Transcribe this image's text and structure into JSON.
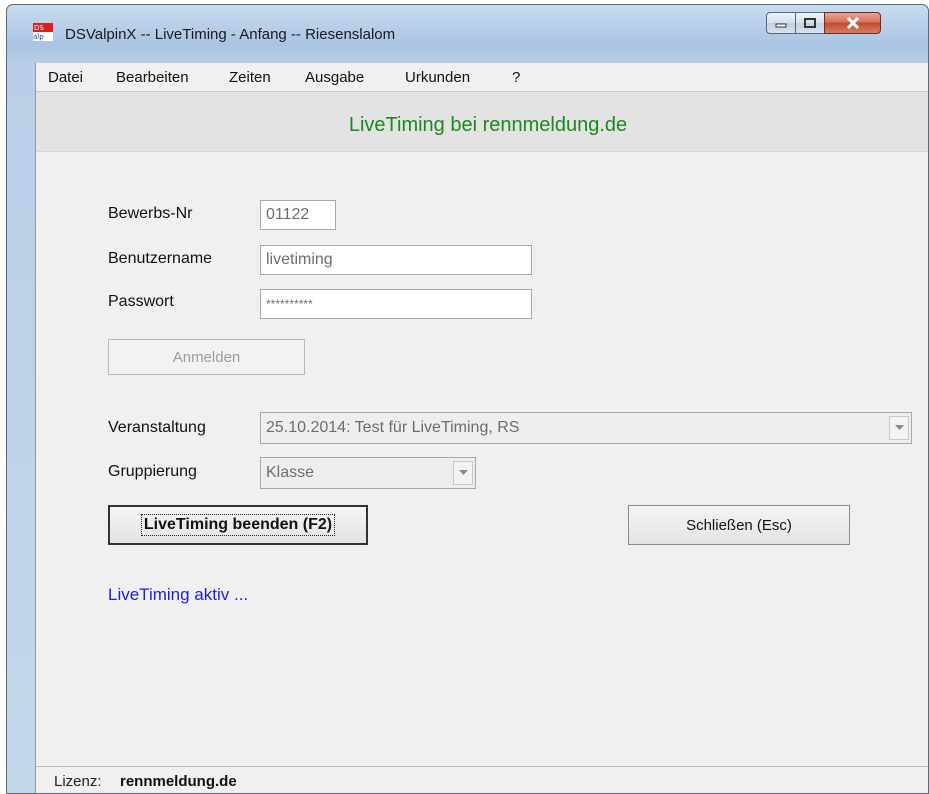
{
  "window": {
    "title": "DSValpinX -- LiveTiming - Anfang -- Riesenslalom",
    "icon": "ds-valpin-app-icon"
  },
  "menu": [
    "Datei",
    "Bearbeiten",
    "Zeiten",
    "Ausgabe",
    "Urkunden",
    "?"
  ],
  "banner": {
    "text": "LiveTiming bei rennmeldung.de",
    "color": "#1b8a1b"
  },
  "form": {
    "bewerbs_label": "Bewerbs-Nr",
    "bewerbs_value": "01122",
    "user_label": "Benutzername",
    "user_value": "livetiming",
    "pass_label": "Passwort",
    "pass_value": "**********",
    "login_button": "Anmelden",
    "event_label": "Veranstaltung",
    "event_value": "25.10.2014: Test für LiveTiming, RS",
    "group_label": "Gruppierung",
    "group_value": "Klasse"
  },
  "actions": {
    "stop_label": "LiveTiming beenden (F2)",
    "close_label": "Schließen (Esc)"
  },
  "status": {
    "text": "LiveTiming aktiv ...",
    "color": "#1f1fd6"
  },
  "footer": {
    "license_label": "Lizenz:",
    "license_value": "rennmeldung.de"
  }
}
